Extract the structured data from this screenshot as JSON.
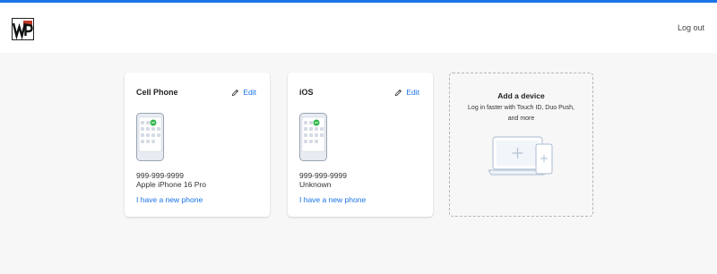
{
  "header": {
    "logo_text": "WP",
    "logout_label": "Log out"
  },
  "devices": [
    {
      "name": "Cell Phone",
      "edit_label": "Edit",
      "phone_number": "999-999-9999",
      "model": "Apple iPhone 16 Pro",
      "new_phone_label": "I have a new phone"
    },
    {
      "name": "iOS",
      "edit_label": "Edit",
      "phone_number": "999-999-9999",
      "model": "Unknown",
      "new_phone_label": "I have a new phone"
    }
  ],
  "add_device": {
    "title": "Add a device",
    "subtitle": "Log in faster with Touch ID, Duo Push, and more"
  },
  "colors": {
    "accent": "#1a73e8",
    "check_badge": "#2db54a",
    "background": "#f7f7f8"
  },
  "icons": {
    "logo": "wp-logo",
    "edit": "pencil-icon",
    "phone": "phone-illustration",
    "add": "add-device-illustration"
  }
}
